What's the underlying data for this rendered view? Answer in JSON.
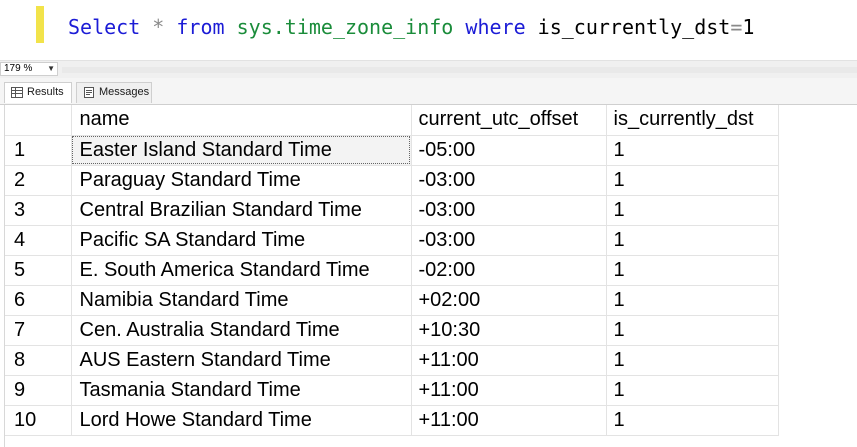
{
  "editor": {
    "query_tokens": [
      {
        "text": "Select",
        "kind": "kw"
      },
      {
        "text": " ",
        "kind": "txt"
      },
      {
        "text": "*",
        "kind": "op"
      },
      {
        "text": " ",
        "kind": "txt"
      },
      {
        "text": "from",
        "kind": "kw"
      },
      {
        "text": " ",
        "kind": "txt"
      },
      {
        "text": "sys.time_zone_info",
        "kind": "obj"
      },
      {
        "text": " ",
        "kind": "txt"
      },
      {
        "text": "where",
        "kind": "kw"
      },
      {
        "text": " is_currently_dst",
        "kind": "txt"
      },
      {
        "text": "=",
        "kind": "op"
      },
      {
        "text": "1",
        "kind": "num"
      }
    ]
  },
  "zoom": {
    "value": "179 %"
  },
  "tabs": {
    "results": "Results",
    "messages": "Messages"
  },
  "grid": {
    "columns": [
      "name",
      "current_utc_offset",
      "is_currently_dst"
    ],
    "rows": [
      {
        "num": "1",
        "name": "Easter Island Standard Time",
        "offset": "-05:00",
        "dst": "1"
      },
      {
        "num": "2",
        "name": "Paraguay Standard Time",
        "offset": "-03:00",
        "dst": "1"
      },
      {
        "num": "3",
        "name": "Central Brazilian Standard Time",
        "offset": "-03:00",
        "dst": "1"
      },
      {
        "num": "4",
        "name": "Pacific SA Standard Time",
        "offset": "-03:00",
        "dst": "1"
      },
      {
        "num": "5",
        "name": "E. South America Standard Time",
        "offset": "-02:00",
        "dst": "1"
      },
      {
        "num": "6",
        "name": "Namibia Standard Time",
        "offset": "+02:00",
        "dst": "1"
      },
      {
        "num": "7",
        "name": "Cen. Australia Standard Time",
        "offset": "+10:30",
        "dst": "1"
      },
      {
        "num": "8",
        "name": "AUS Eastern Standard Time",
        "offset": "+11:00",
        "dst": "1"
      },
      {
        "num": "9",
        "name": "Tasmania Standard Time",
        "offset": "+11:00",
        "dst": "1"
      },
      {
        "num": "10",
        "name": "Lord Howe Standard Time",
        "offset": "+11:00",
        "dst": "1"
      }
    ]
  }
}
